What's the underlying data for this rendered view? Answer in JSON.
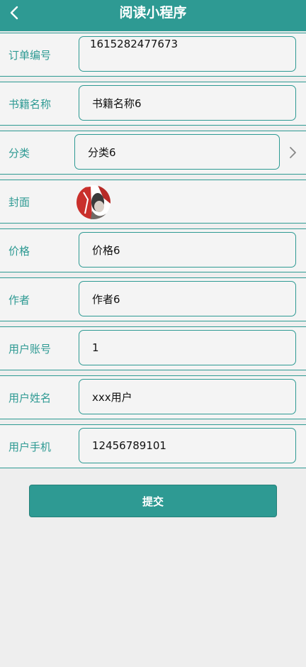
{
  "header": {
    "title": "阅读小程序",
    "back_icon": "chevron-left-icon"
  },
  "form": {
    "order_no": {
      "label": "订单编号",
      "value": "1615282477673"
    },
    "book_name": {
      "label": "书籍名称",
      "value": "书籍名称6"
    },
    "category": {
      "label": "分类",
      "value": "分类6",
      "arrow_icon": "chevron-right-icon"
    },
    "cover": {
      "label": "封面",
      "image": "book-cover-thumbnail"
    },
    "price": {
      "label": "价格",
      "value": "价格6"
    },
    "author": {
      "label": "作者",
      "value": "作者6"
    },
    "user_account": {
      "label": "用户账号",
      "value": "1"
    },
    "user_name": {
      "label": "用户姓名",
      "value": "xxx用户"
    },
    "user_phone": {
      "label": "用户手机",
      "value": "12456789101"
    }
  },
  "submit": {
    "label": "提交"
  },
  "colors": {
    "primary": "#2e9a93",
    "background": "#eeeeee",
    "field_bg": "#f4f4f4"
  }
}
